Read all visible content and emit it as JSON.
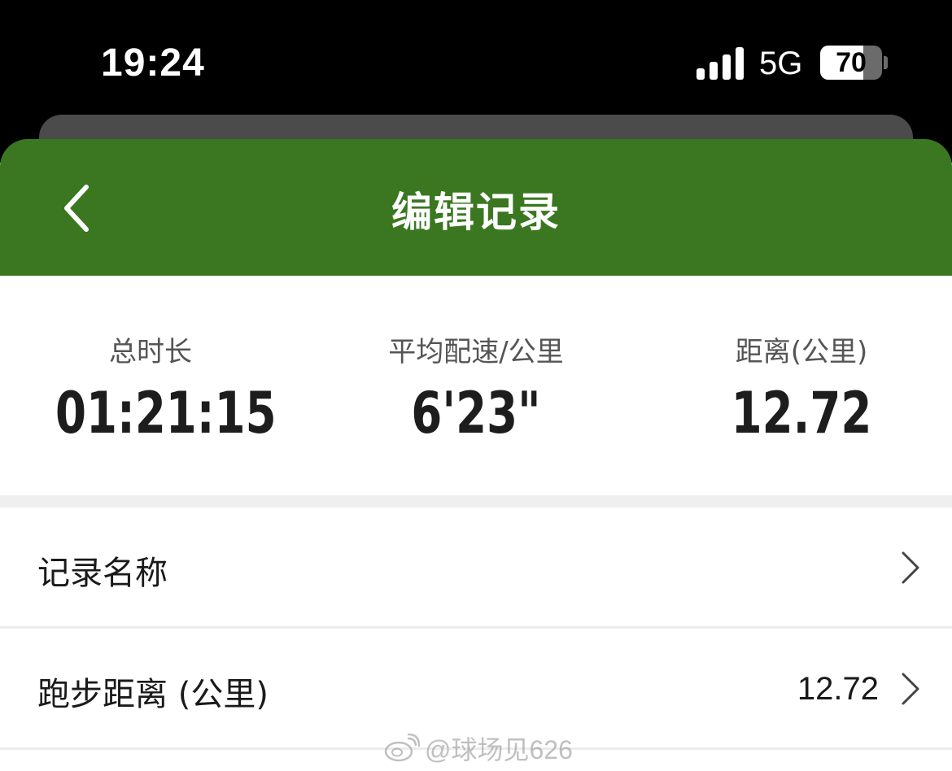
{
  "status_bar": {
    "time": "19:24",
    "network": "5G",
    "battery_level": "70",
    "battery_fraction": 0.7
  },
  "header": {
    "title": "编辑记录",
    "back_icon": "chevron-left-icon",
    "color": "#3a7720"
  },
  "stats": [
    {
      "label": "总时长",
      "value": "01:21:15"
    },
    {
      "label": "平均配速/公里",
      "value": "6'23\""
    },
    {
      "label": "距离(公里)",
      "value": "12.72"
    }
  ],
  "rows": [
    {
      "label": "记录名称",
      "value": ""
    },
    {
      "label": "跑步距离 (公里)",
      "value": "12.72"
    }
  ],
  "watermark": {
    "text": "@球场见626",
    "icon": "weibo-logo-icon"
  }
}
